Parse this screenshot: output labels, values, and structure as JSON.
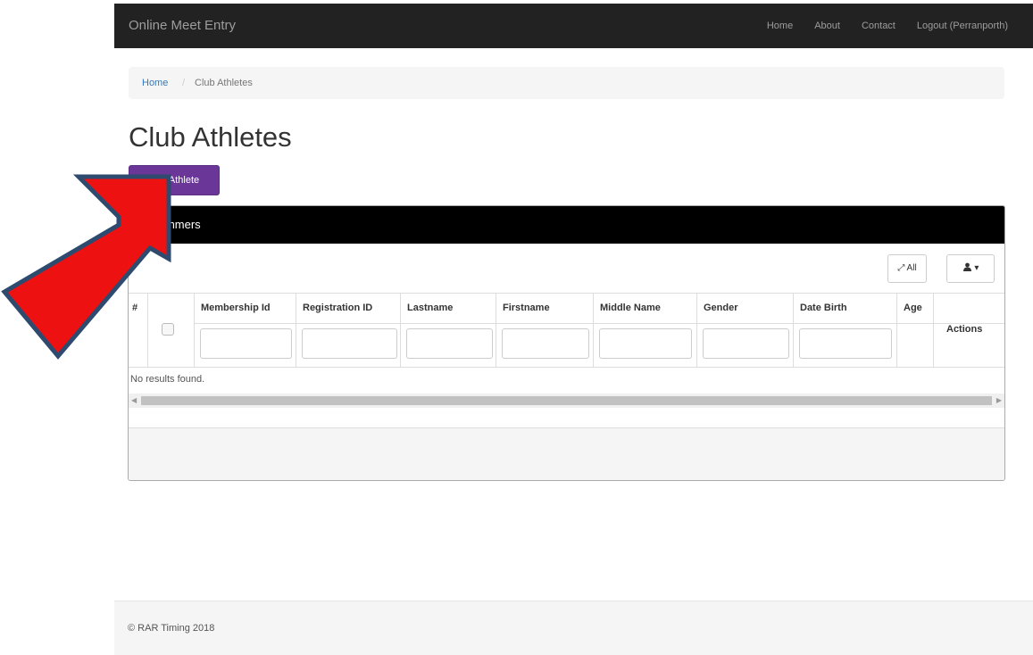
{
  "navbar": {
    "brand": "Online Meet Entry",
    "links": [
      "Home",
      "About",
      "Contact",
      "Logout (Perranporth)"
    ]
  },
  "breadcrumb": {
    "home": "Home",
    "separator": "/",
    "current": "Club Athletes"
  },
  "page": {
    "title": "Club Athletes",
    "add_button": "Add Athlete"
  },
  "grid": {
    "panel_title": "Swimmers",
    "toolbar": {
      "all_label": "All",
      "columns_caret": "▾"
    },
    "columns": [
      {
        "label": "#"
      },
      {
        "label": ""
      },
      {
        "label": "Membership Id"
      },
      {
        "label": "Registration ID"
      },
      {
        "label": "Lastname"
      },
      {
        "label": "Firstname"
      },
      {
        "label": "Middle Name"
      },
      {
        "label": "Gender"
      },
      {
        "label": "Date Birth"
      },
      {
        "label": "Age"
      },
      {
        "label": "Actions"
      }
    ],
    "empty_message": "No results found."
  },
  "footer": {
    "copyright": "© RAR Timing 2018"
  },
  "colors": {
    "navbar": "#222222",
    "accent_button": "#6a3799",
    "panel_heading": "#000000",
    "annotation_arrow": "#ee1111"
  },
  "annotation": {
    "icon": "red-arrow"
  }
}
